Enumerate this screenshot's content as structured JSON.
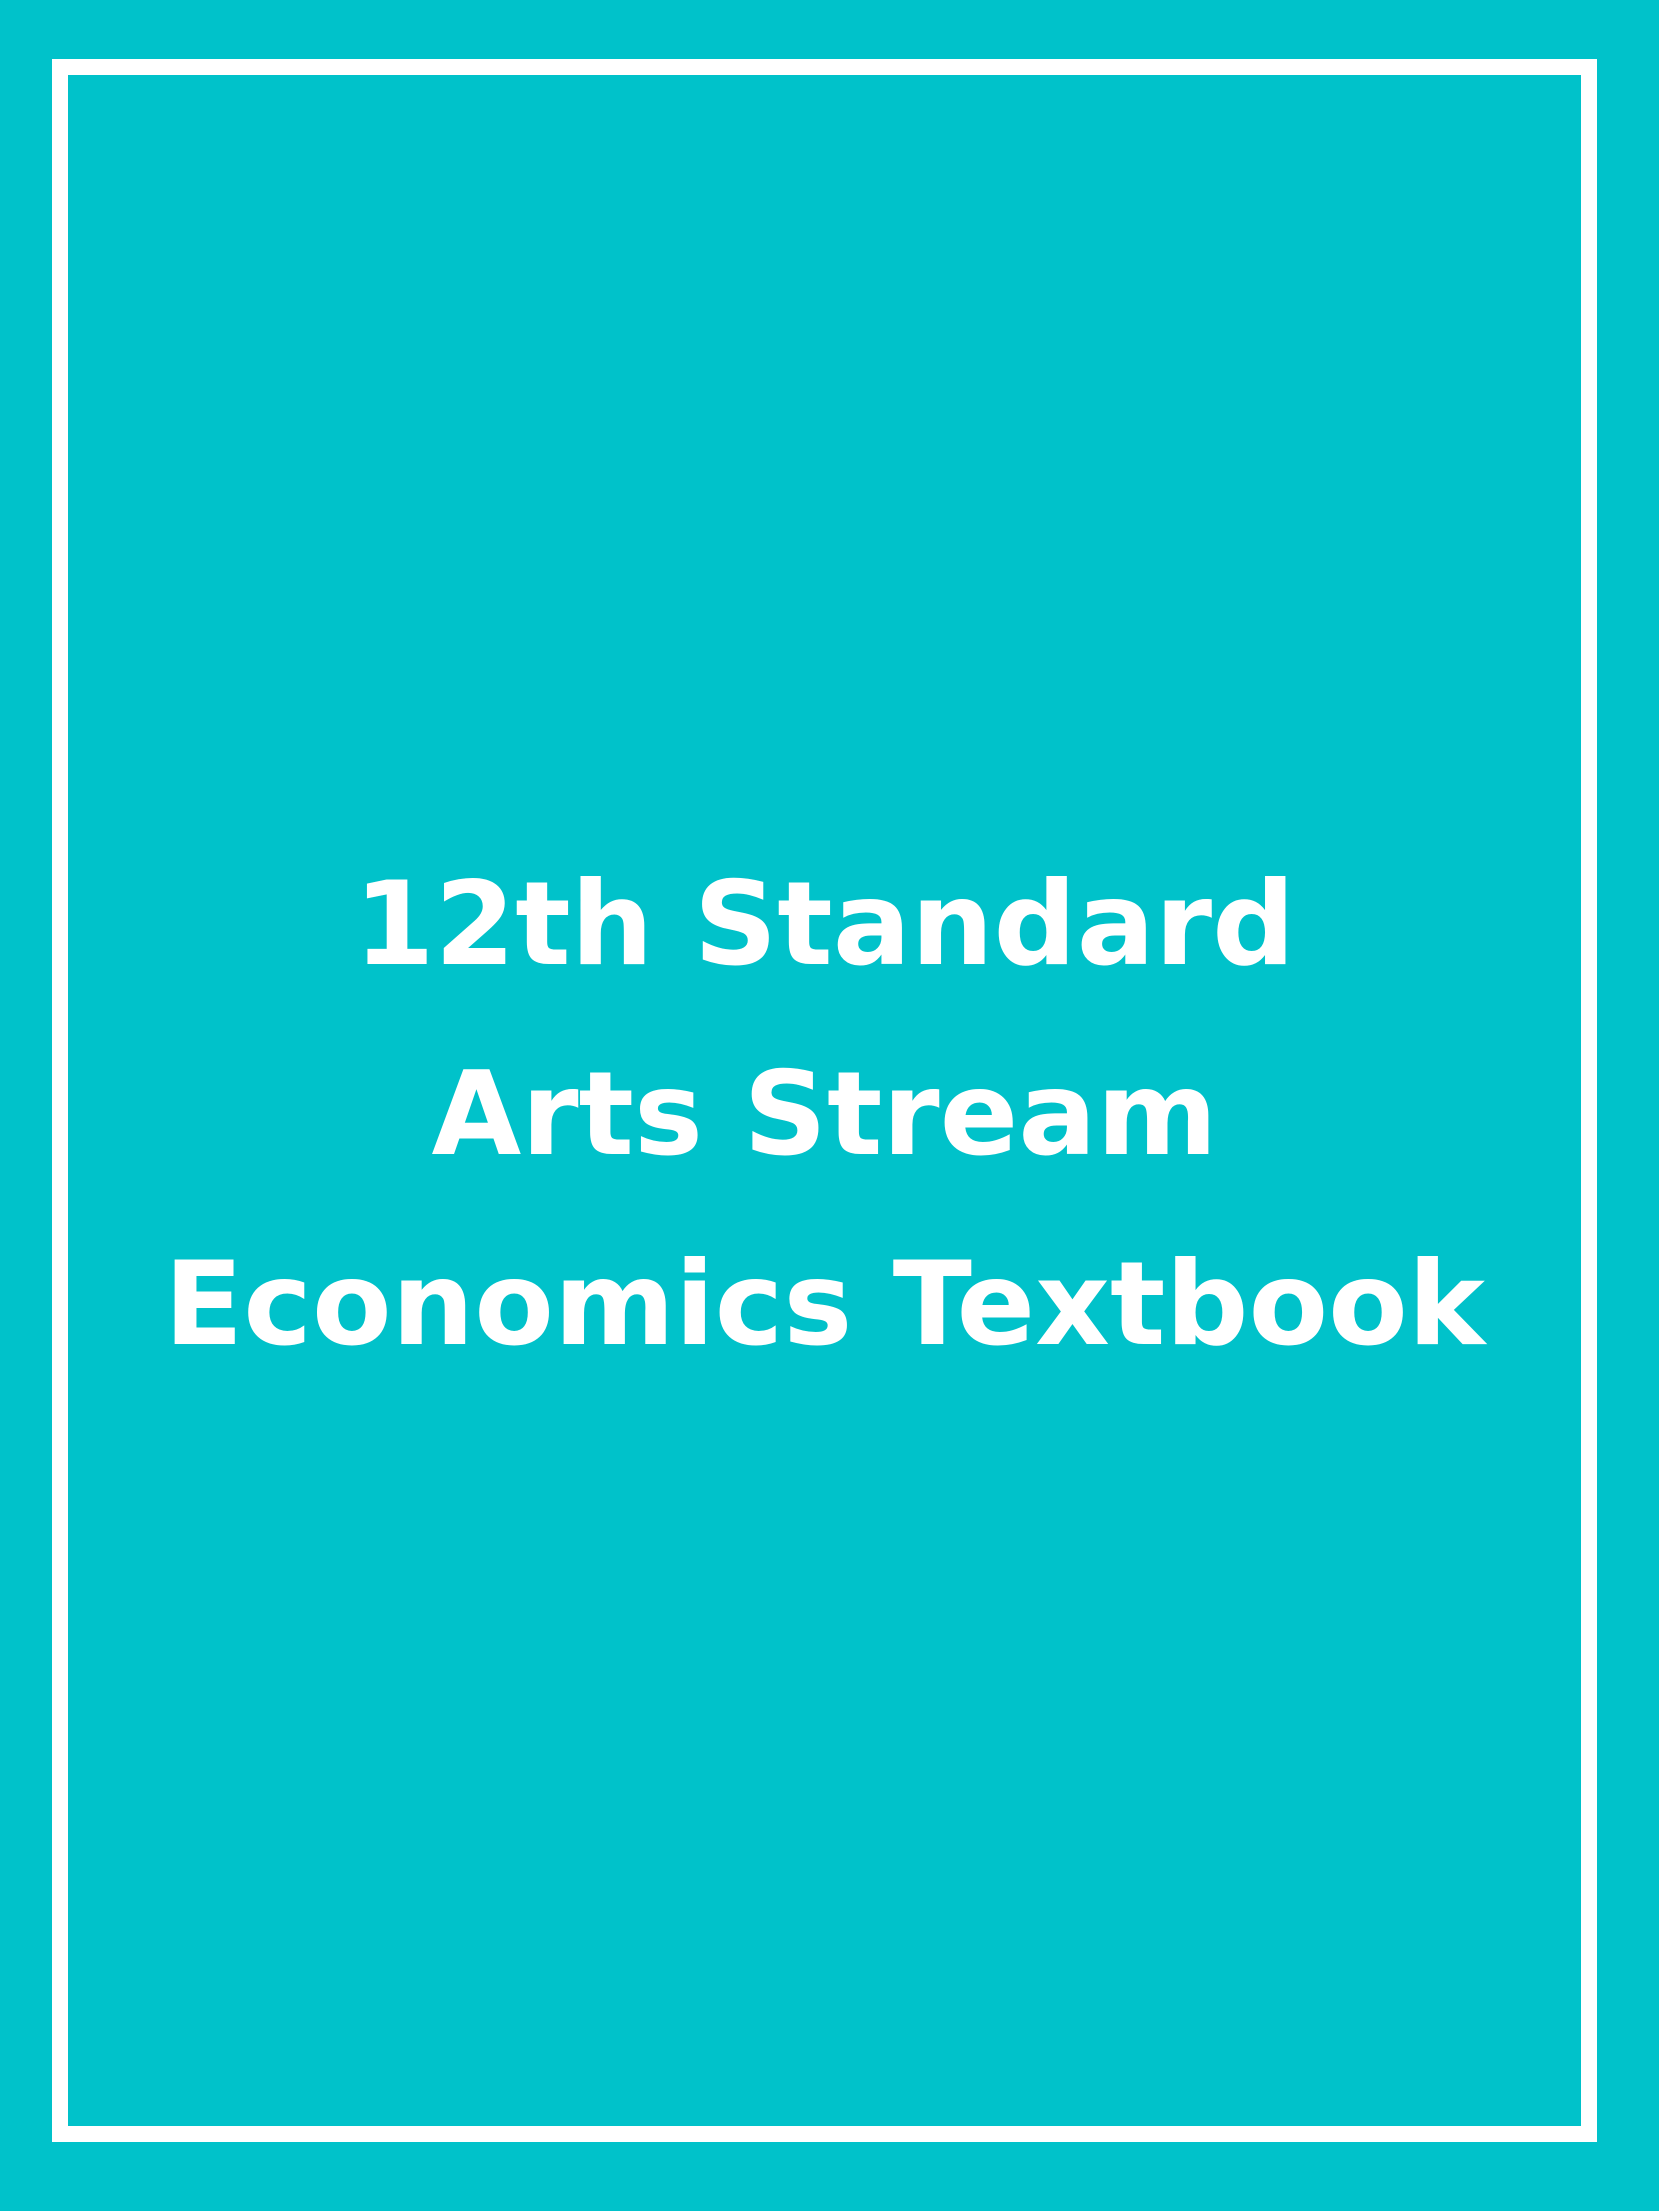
{
  "cover": {
    "background_color": "#00c2ca",
    "frame_color": "#ffffff",
    "title_lines": [
      "12th Standard",
      "Arts Stream",
      "Economics Textbook"
    ]
  }
}
